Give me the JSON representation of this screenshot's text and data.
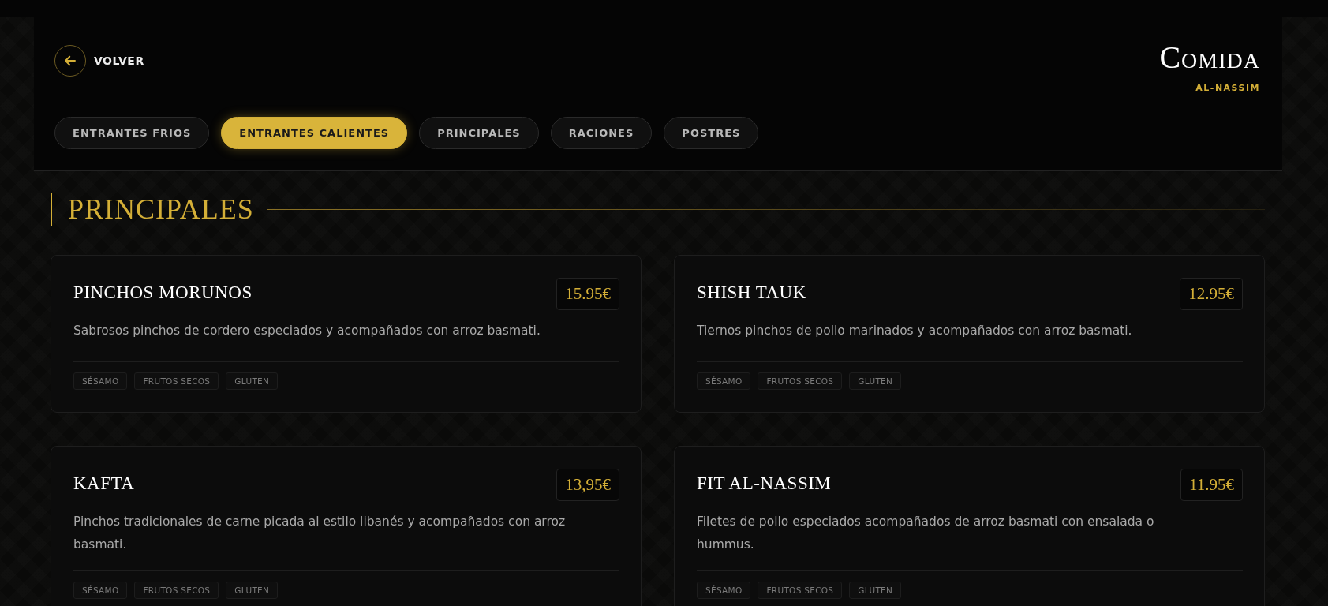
{
  "back": {
    "label": "VOLVER"
  },
  "header": {
    "title": "Comida",
    "subtitle": "AL-NASSIM"
  },
  "tabs": [
    {
      "label": "ENTRANTES FRIOS",
      "selected": false
    },
    {
      "label": "ENTRANTES CALIENTES",
      "selected": true
    },
    {
      "label": "PRINCIPALES",
      "selected": false
    },
    {
      "label": "RACIONES",
      "selected": false
    },
    {
      "label": "POSTRES",
      "selected": false
    }
  ],
  "section": {
    "title": "PRINCIPALES",
    "items": [
      {
        "name": "PINCHOS MORUNOS",
        "price": "15.95€",
        "description": "Sabrosos pinchos de cordero especiados y acompañados con arroz basmati.",
        "allergens": [
          "SÉSAMO",
          "FRUTOS SECOS",
          "GLUTEN"
        ]
      },
      {
        "name": "SHISH TAUK",
        "price": "12.95€",
        "description": "Tiernos pinchos de pollo marinados y acompañados con arroz basmati.",
        "allergens": [
          "SÉSAMO",
          "FRUTOS SECOS",
          "GLUTEN"
        ]
      },
      {
        "name": "KAFTA",
        "price": "13,95€",
        "description": "Pinchos tradicionales de carne picada al estilo libanés y acompañados con arroz basmati.",
        "allergens": [
          "SÉSAMO",
          "FRUTOS SECOS",
          "GLUTEN"
        ]
      },
      {
        "name": "FIT AL-NASSIM",
        "price": "11.95€",
        "description": "Filetes de pollo especiados acompañados de arroz basmati con ensalada o hummus.",
        "allergens": [
          "SÉSAMO",
          "FRUTOS SECOS",
          "GLUTEN"
        ]
      }
    ]
  }
}
